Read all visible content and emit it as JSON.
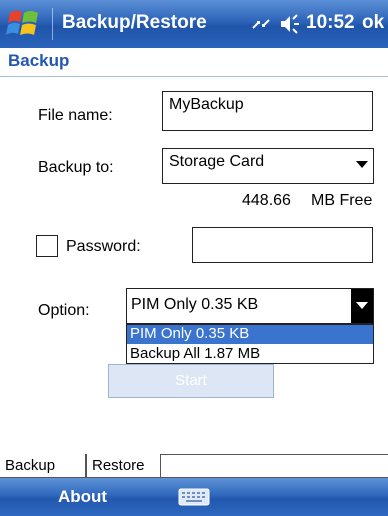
{
  "titlebar": {
    "title": "Backup/Restore",
    "time": "10:52",
    "ok_label": "ok",
    "icons": [
      "windows-start-icon",
      "connectivity-icon",
      "volume-icon"
    ]
  },
  "page": {
    "title": "Backup"
  },
  "form": {
    "file_name_label": "File name:",
    "file_name_value": "MyBackup",
    "backup_to_label": "Backup to:",
    "backup_to_value": "Storage Card",
    "free_amount": "448.66",
    "free_unit": "MB Free",
    "password_label": "Password:",
    "password_value": "",
    "password_checked": false,
    "option_label": "Option:",
    "option_value": "PIM Only  0.35 KB",
    "option_list": [
      "PIM Only  0.35 KB",
      "Backup All   1.87 MB"
    ],
    "start_label": "Start"
  },
  "tabs": {
    "items": [
      "Backup",
      "Restore"
    ],
    "active": "Backup"
  },
  "softkeys": {
    "left": "About"
  },
  "colors": {
    "title_bar": "#2c63b8",
    "accent_text": "#2458b0",
    "selection": "#3a74cf"
  }
}
